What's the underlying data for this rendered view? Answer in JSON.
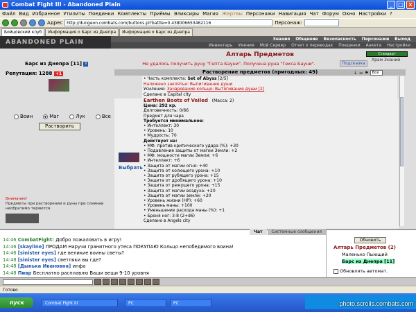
{
  "window": {
    "title": "Combat Fight III - Abandoned Plain"
  },
  "menu": [
    "Файл",
    "Вид",
    "Избранное",
    "Утилиты",
    "Поединки",
    "Комплекты",
    "Приёмы",
    "Эликсиры",
    "Магия",
    "Жертвы",
    "Персонажи",
    "Навигация",
    "Чат",
    "Форум",
    "Окно",
    "Настройки",
    "?"
  ],
  "toolbar": {
    "address_label": "Адрес",
    "address": "http://dungeon.combats.com/buttons.pl?battle=0.438006653462116",
    "person_label": "Персонаж:"
  },
  "tabs": [
    "Бойцовский клуб",
    "Информация о Барс из Днепра",
    "Информация о Барс из Днепра"
  ],
  "game": {
    "logo": "ABANDONED PLAIN",
    "nav_top": [
      "Знания",
      "Общение",
      "Безопасность",
      "Персонажи",
      "Выход"
    ],
    "nav_sub": [
      "Инвентарь",
      "Умения",
      "Мой Сервер",
      "Отчет о переводах",
      "Поединки",
      "Анкета",
      "Настройки"
    ]
  },
  "player": {
    "name": "Барс из Днепра",
    "level": "[11]",
    "reputation_label": "Репутация:",
    "reputation": "1288",
    "badge": "+1"
  },
  "classes": {
    "warrior": "Воин",
    "mage": "Маг",
    "archer": "Лук",
    "all": "Все",
    "dissolve_button": "Растворить"
  },
  "warning": {
    "title": "Внимание!",
    "text": "Предметы при растворении и руны при слиянии необратимо теряются."
  },
  "altar": {
    "title": "Алтарь Предметов",
    "message": "Не удалось получить руну \"Гепта Бауни\". Получена руна \"Гекса Бауни\".",
    "hint": "Подсказка",
    "section": "Растворение предметов (пригодных: 49)",
    "filter_value": "Все"
  },
  "item_top": {
    "set_line": "• Часть комплекта: ",
    "set_name": "Set of Abyss",
    "set_count": " [2/5]",
    "spell": "Наложено заклятье: Выпигивание души",
    "enchant": "Усиление: ",
    "enchant_link": "Зачарование кольцо: Вытягивание души [2]",
    "made": "Сделано в Capital city"
  },
  "item": {
    "name": "Earthen Boots of Veiled",
    "weight": "(Масса: 2)",
    "price": "Цена: 292 кр.",
    "durability": "Долговечность: 0/66",
    "type": "Предмет для чара",
    "req_title": "Требуется минимальное:",
    "req": [
      "• Интеллект: 30",
      "• Уровень: 10",
      "• Мудрость: 70"
    ],
    "acts_title": "Действует на:",
    "acts": [
      "• МФ. против критического удара (%): +30",
      "• Подавление защиты от магии Земли: +2",
      "• МФ. мощности магии Земли: +6",
      "• Интеллект: +6",
      "• Защита от магии огня: +40",
      "• Защита от колющего урона: +10",
      "• Защита от рубящего урона: +15",
      "• Защита от дробящего урона: +10",
      "• Защита от режущего урона: +15",
      "• Защита от магии воздуха: +20",
      "• Защита от магии земли: +20",
      "• Уровень жизни (HP): +60",
      "• Уровень маны: +100",
      "• Уменьшение расхода маны (%): +1",
      "• Броня ног: 3-8 (2+d6)",
      "Сделано в Angels city"
    ],
    "choose": "Выбрать"
  },
  "right": {
    "green": "Стандарт",
    "name": "Храм Знаний"
  },
  "chat": {
    "tabs": [
      "Чат",
      "Системные сообщения"
    ],
    "lines": [
      {
        "time": "14:46",
        "name": "CombatFight:",
        "text": "Добро пожаловать в игру!"
      },
      {
        "time": "14:46",
        "name": "[skayline]",
        "text": "ПРОДАМ Наручи гранитного утеса ПОКУПАЮ Кольцо непобедимого воина!"
      },
      {
        "time": "14:46",
        "name": "[sinister eyes]",
        "text": "где великие воины светы?"
      },
      {
        "time": "14:48",
        "name": "[sinister eyes]",
        "text": "светляки вы где?"
      },
      {
        "time": "14:48",
        "name": "[Дынька Ивановна]",
        "text": "инфа"
      },
      {
        "time": "14:48",
        "name": "Пивр",
        "text": "Бесплатно расплавлю Ваши вещи 9-10 уровня"
      }
    ],
    "refresh": "Обновить",
    "room": "Алтарь Предметов (2)",
    "occupants": [
      "Маленько Пыющий",
      "Барс из Днепра [11]"
    ],
    "autorefresh": "Обновлять автомат."
  },
  "status": "Готово",
  "taskbar": {
    "start": "пуск",
    "items": [
      "Combat Fight III",
      "PC",
      "PC"
    ],
    "watermark": "photo.scrolls.combats.com"
  }
}
